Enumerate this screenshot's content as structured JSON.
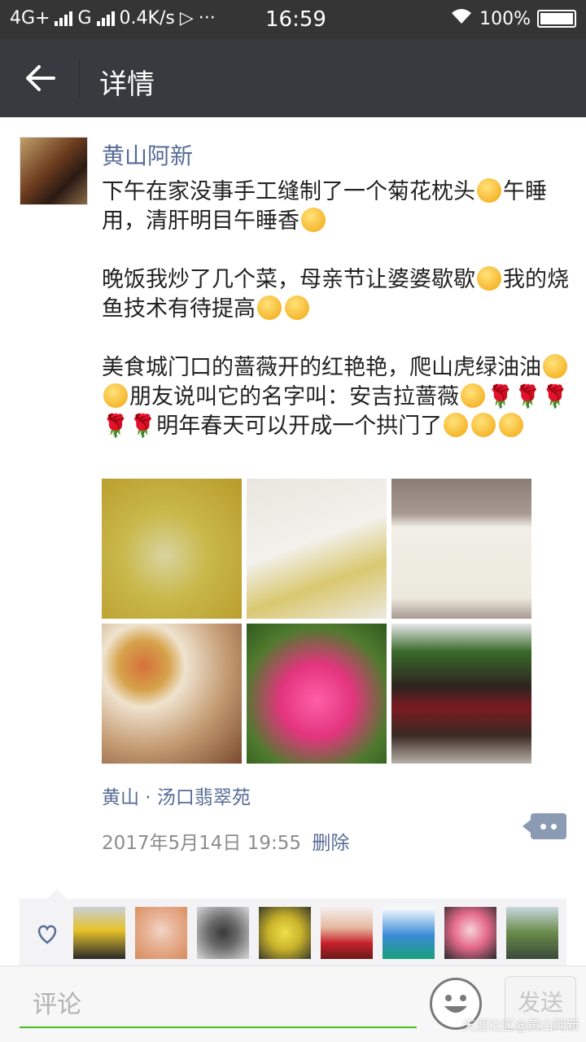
{
  "status_bar": {
    "network": "4G+",
    "network2": "G",
    "speed": "0.4K/s",
    "dots": "···",
    "time": "16:59",
    "battery": "100%"
  },
  "app_bar": {
    "title": "详情",
    "back_icon": "arrow-left-icon"
  },
  "post": {
    "author": "黄山阿新",
    "paragraphs": [
      [
        "下午在家没事手工缝制了一个菊花枕头",
        "午睡用，清肝明目午睡香",
        ""
      ],
      [
        "晚饭我炒了几个菜，母亲节让婆婆歇歇",
        "我的烧鱼技术有待提高",
        "",
        ""
      ],
      [
        "美食城门口的蔷薇开的红艳艳，爬山虎绿油油",
        "",
        "朋友说叫它的名字叫：安吉拉蔷薇",
        "",
        "明年春天可以开成一个拱门了",
        "",
        ""
      ]
    ],
    "photos": [
      "chrysanthemum-petals",
      "pillow-filling",
      "finished-pillow",
      "dinner-dishes",
      "pink-roses",
      "shop-entrance-roses"
    ],
    "location": "黄山 · 汤口翡翠苑",
    "date": "2017年5月14日 19:55",
    "delete_label": "删除"
  },
  "comment": {
    "placeholder": "评论",
    "send_label": "发送"
  },
  "watermark": "天涯社区@黄山阿新"
}
